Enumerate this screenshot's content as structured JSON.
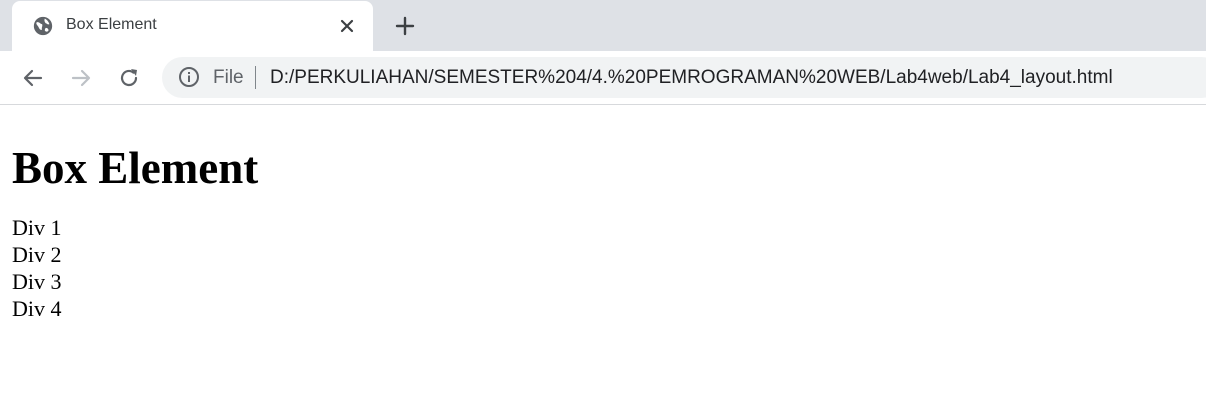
{
  "browser": {
    "tab": {
      "title": "Box Element"
    },
    "address_bar": {
      "scheme_label": "File",
      "url": "D:/PERKULIAHAN/SEMESTER%204/4.%20PEMROGRAMAN%20WEB/Lab4web/Lab4_layout.html"
    }
  },
  "page": {
    "heading": "Box Element",
    "divs": [
      "Div 1",
      "Div 2",
      "Div 3",
      "Div 4"
    ]
  },
  "colors": {
    "tabstrip": "#dee1e6",
    "omnibox": "#f1f3f4",
    "icon": "#5f6368",
    "icon_disabled": "#bdc1c6"
  },
  "icons": [
    "globe-icon",
    "close-icon",
    "plus-icon",
    "back-arrow-icon",
    "forward-arrow-icon",
    "reload-icon",
    "info-icon"
  ]
}
